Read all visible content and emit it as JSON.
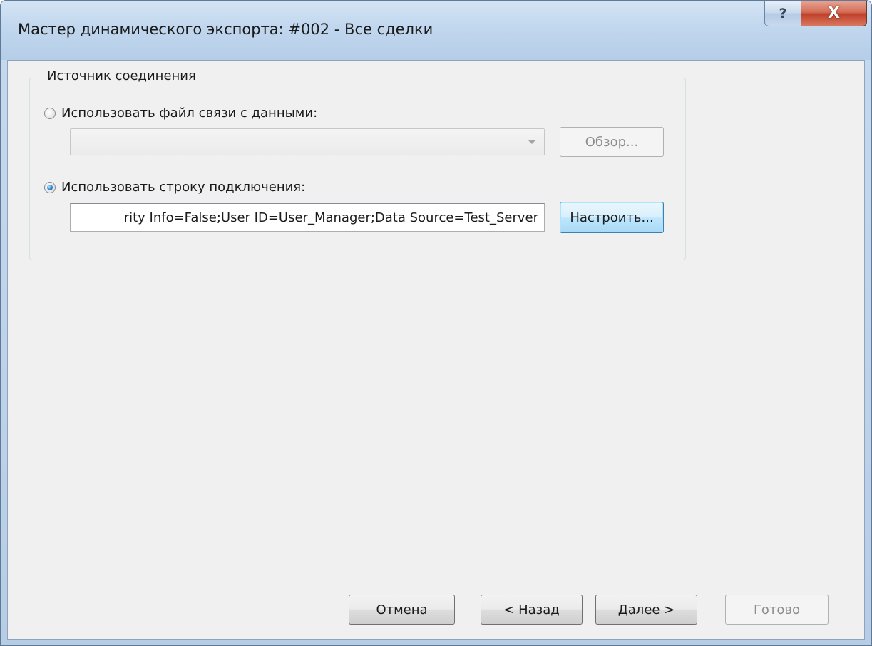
{
  "window": {
    "title": "Мастер динамического экспорта: #002 - Все сделки",
    "help_label": "?",
    "close_label": "X"
  },
  "connection_source": {
    "group_label": "Источник соединения",
    "options": [
      {
        "label": "Использовать файл связи с данными:",
        "selected": false
      },
      {
        "label": "Использовать строку подключения:",
        "selected": true
      }
    ],
    "data_link_file": {
      "value": "",
      "enabled": false
    },
    "browse_label": "Обзор...",
    "connection_string": "rity Info=False;User ID=User_Manager;Data Source=Test_Server",
    "configure_label": "Настроить..."
  },
  "footer": {
    "cancel_label": "Отмена",
    "back_label": "< Назад",
    "next_label": "Далее >",
    "finish_label": "Готово"
  }
}
